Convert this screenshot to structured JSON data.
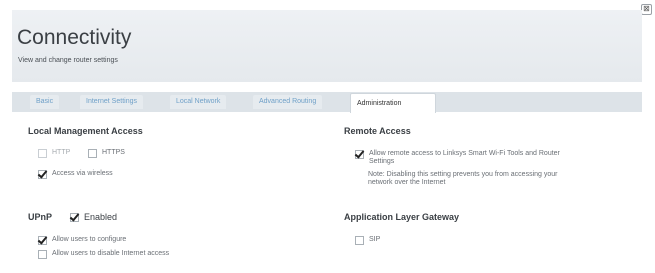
{
  "window": {
    "close_glyph": "⊠"
  },
  "header": {
    "title": "Connectivity",
    "subtitle": "View and change router settings"
  },
  "tabs": [
    {
      "label": "Basic",
      "active": false
    },
    {
      "label": "Internet Settings",
      "active": false
    },
    {
      "label": "Local Network",
      "active": false
    },
    {
      "label": "Advanced Routing",
      "active": false
    },
    {
      "label": "Administration",
      "active": true
    }
  ],
  "local_management": {
    "title": "Local Management Access",
    "http_label": "HTTP",
    "http_checked": false,
    "https_label": "HTTPS",
    "https_checked": false,
    "wireless_label": "Access via wireless",
    "wireless_checked": true
  },
  "upnp": {
    "title": "UPnP",
    "enabled_label": "Enabled",
    "enabled_checked": true,
    "configure_label": "Allow users to configure",
    "configure_checked": true,
    "disable_internet_label": "Allow users to disable Internet access",
    "disable_internet_checked": false
  },
  "remote_access": {
    "title": "Remote Access",
    "allow_label_line1": "Allow remote access to Linksys Smart Wi-Fi Tools and Router",
    "allow_label_line2": "Settings",
    "allow_checked": true,
    "note_line1": "Note: Disabling this setting prevents you from accessing your",
    "note_line2": "network over the Internet"
  },
  "alg": {
    "title": "Application Layer Gateway",
    "sip_label": "SIP",
    "sip_checked": false
  },
  "colors": {
    "tab_link": "#6fa0c8",
    "header_bg": "#e9edf1",
    "text_dark": "#3a3f44"
  }
}
